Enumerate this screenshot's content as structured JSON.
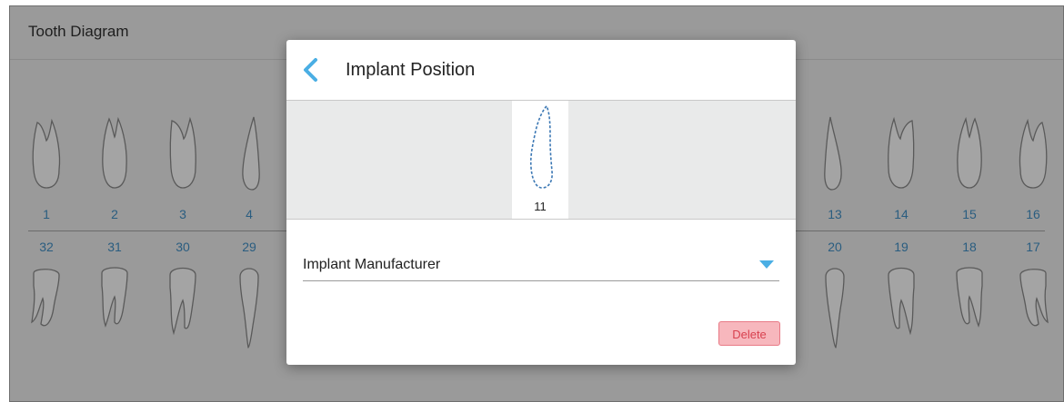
{
  "panel": {
    "title": "Tooth Diagram"
  },
  "upper_teeth": [
    {
      "number": "1"
    },
    {
      "number": "2"
    },
    {
      "number": "3"
    },
    {
      "number": "4"
    },
    {
      "number": "13"
    },
    {
      "number": "14"
    },
    {
      "number": "15"
    },
    {
      "number": "16"
    }
  ],
  "lower_teeth": [
    {
      "number": "32"
    },
    {
      "number": "31"
    },
    {
      "number": "30"
    },
    {
      "number": "29"
    },
    {
      "number": "20"
    },
    {
      "number": "19"
    },
    {
      "number": "18"
    },
    {
      "number": "17"
    }
  ],
  "modal": {
    "title": "Implant Position",
    "back_icon": "chevron-left-icon",
    "selected_tooth": "11",
    "manufacturer_label": "Implant Manufacturer",
    "delete_label": "Delete"
  },
  "colors": {
    "accent": "#4aaee4",
    "tooth_number": "#2a5d80",
    "delete_bg": "#f7b7bd",
    "delete_text": "#d8414f"
  }
}
